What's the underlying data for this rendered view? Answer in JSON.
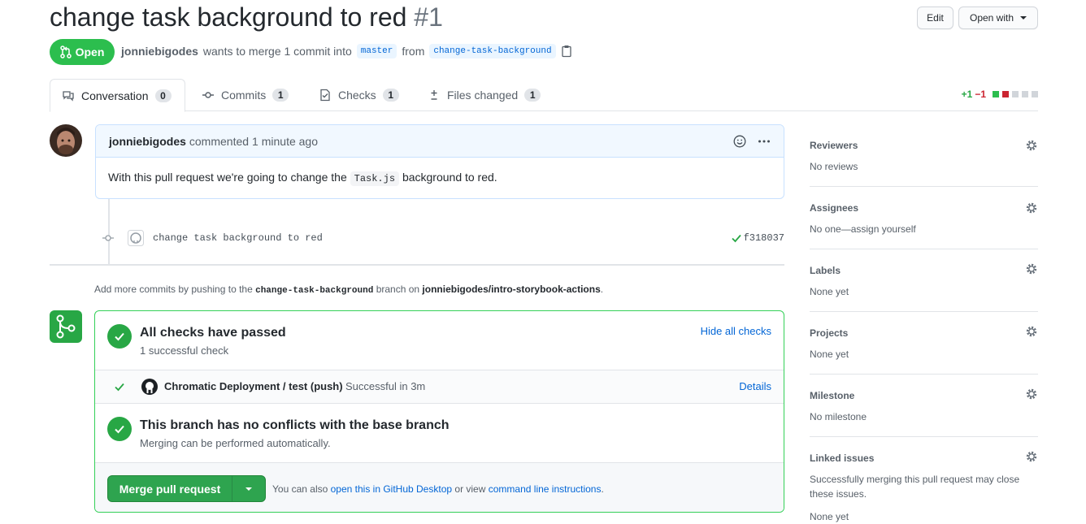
{
  "pr": {
    "title": "change task background to red",
    "number": "#1",
    "state": "Open",
    "author": "jonniebigodes",
    "action_text": "wants to merge 1 commit into",
    "base_branch": "master",
    "from_text": "from",
    "head_branch": "change-task-background"
  },
  "header_actions": {
    "edit_label": "Edit",
    "open_with_label": "Open with"
  },
  "tabs": [
    {
      "label": "Conversation",
      "count": "0",
      "icon": "comment-discussion-icon",
      "selected": true
    },
    {
      "label": "Commits",
      "count": "1",
      "icon": "git-commit-icon",
      "selected": false
    },
    {
      "label": "Checks",
      "count": "1",
      "icon": "checklist-icon",
      "selected": false
    },
    {
      "label": "Files changed",
      "count": "1",
      "icon": "diff-icon",
      "selected": false
    }
  ],
  "diffstat": {
    "additions": "+1",
    "deletions": "−1"
  },
  "comment": {
    "author": "jonniebigodes",
    "action": "commented",
    "time": "1 minute ago",
    "body_before": "With this pull request we're going to change the",
    "body_code": "Task.js",
    "body_after": "background to red."
  },
  "commit": {
    "message": "change task background to red",
    "sha": "f318037"
  },
  "hint": {
    "prefix": "Add more commits by pushing to the",
    "branch": "change-task-background",
    "middle": "branch on",
    "repo": "jonniebigodes/intro-storybook-actions",
    "suffix": "."
  },
  "merge_box": {
    "checks_title": "All checks have passed",
    "checks_sub": "1 successful check",
    "hide_checks_label": "Hide all checks",
    "check_name": "Chromatic Deployment / test (push)",
    "check_status": "Successful in 3m",
    "details_label": "Details",
    "conflicts_title": "This branch has no conflicts with the base branch",
    "conflicts_sub": "Merging can be performed automatically.",
    "merge_button_label": "Merge pull request",
    "also_text": "You can also",
    "desktop_link": "open this in GitHub Desktop",
    "or_view_text": "or view",
    "cli_link": "command line instructions",
    "period": "."
  },
  "sidebar": {
    "reviewers": {
      "heading": "Reviewers",
      "value": "No reviews"
    },
    "assignees": {
      "heading": "Assignees",
      "value": "No one—assign yourself"
    },
    "labels": {
      "heading": "Labels",
      "value": "None yet"
    },
    "projects": {
      "heading": "Projects",
      "value": "None yet"
    },
    "milestone": {
      "heading": "Milestone",
      "value": "No milestone"
    },
    "linked_issues": {
      "heading": "Linked issues",
      "description": "Successfully merging this pull request may close these issues.",
      "value": "None yet"
    }
  },
  "colors": {
    "open_green": "#2cbe4e",
    "link_blue": "#0366d6",
    "success_green": "#28a745",
    "deletion_red": "#cb2431"
  }
}
